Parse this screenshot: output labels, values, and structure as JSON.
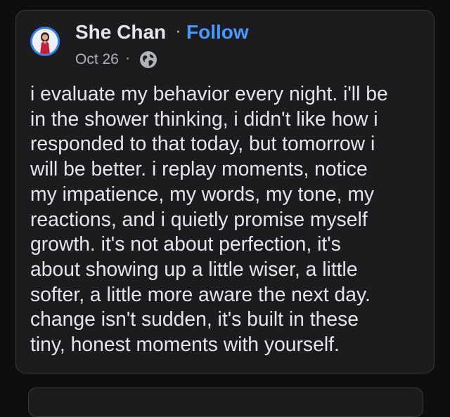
{
  "post": {
    "author_name": "She Chan",
    "separator": "·",
    "follow_label": "Follow",
    "date": "Oct 26",
    "date_separator": "·",
    "visibility_icon": "globe-icon",
    "text": "i evaluate my behavior every night. i'll be\nin the shower thinking, i didn't like how i\nresponded to that today, but tomorrow i\nwill be better. i replay moments, notice\nmy impatience, my words, my tone, my\nreactions, and i quietly promise myself\ngrowth. it's not about perfection, it's\nabout showing up a little wiser, a little\nsofter, a little more aware the next day.\nchange isn't sudden, it's built in these\ntiny, honest moments with yourself."
  },
  "colors": {
    "background": "#0e0e0f",
    "card": "#1c1c1e",
    "border": "#3a3b3d",
    "text_primary": "#e4e6eb",
    "text_secondary": "#b0b3b8",
    "follow_accent": "#4599ff",
    "avatar_ring": "#2f80ed"
  }
}
